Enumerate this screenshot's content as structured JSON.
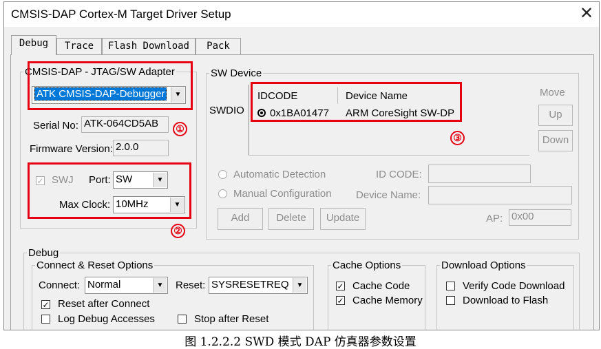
{
  "window": {
    "title": "CMSIS-DAP Cortex-M Target Driver Setup",
    "close": "✕"
  },
  "tabs": [
    "Debug",
    "Trace",
    "Flash Download",
    "Pack"
  ],
  "adapter": {
    "group": "CMSIS-DAP - JTAG/SW Adapter",
    "selected": "ATK CMSIS-DAP-Debugger",
    "serial_label": "Serial No:",
    "serial_value": "ATK-064CD5AB",
    "firmware_label": "Firmware Version:",
    "firmware_value": "2.0.0",
    "swj_label": "SWJ",
    "port_label": "Port:",
    "port_value": "SW",
    "clock_label": "Max Clock:",
    "clock_value": "10MHz"
  },
  "sw_device": {
    "group": "SW Device",
    "row_label": "SWDIO",
    "columns": [
      "IDCODE",
      "Device Name"
    ],
    "rows": [
      {
        "idcode": "0x1BA01477",
        "name": "ARM CoreSight SW-DP"
      }
    ],
    "move_label": "Move",
    "up_button": "Up",
    "down_button": "Down",
    "auto_detect": "Automatic Detection",
    "manual_config": "Manual Configuration",
    "id_code_label": "ID CODE:",
    "device_name_label": "Device Name:",
    "add_button": "Add",
    "delete_button": "Delete",
    "update_button": "Update",
    "ap_label": "AP:",
    "ap_value": "0x00"
  },
  "debug": {
    "group": "Debug",
    "connect_reset_group": "Connect & Reset Options",
    "connect_label": "Connect:",
    "connect_value": "Normal",
    "reset_label": "Reset:",
    "reset_value": "SYSRESETREQ",
    "reset_after_connect": "Reset after Connect",
    "log_debug_accesses": "Log Debug Accesses",
    "stop_after_reset": "Stop after Reset",
    "cache_group": "Cache Options",
    "cache_code": "Cache Code",
    "cache_memory": "Cache Memory",
    "download_group": "Download Options",
    "verify_code_download": "Verify Code Download",
    "download_to_flash": "Download to Flash"
  },
  "markers": [
    "①",
    "②",
    "③"
  ],
  "caption": "图 1.2.2.2 SWD 模式 DAP 仿真器参数设置",
  "colors": {
    "annotation_red": "#e60012",
    "selection_blue": "#0078d7",
    "window_bg": "#f0f0f0"
  }
}
